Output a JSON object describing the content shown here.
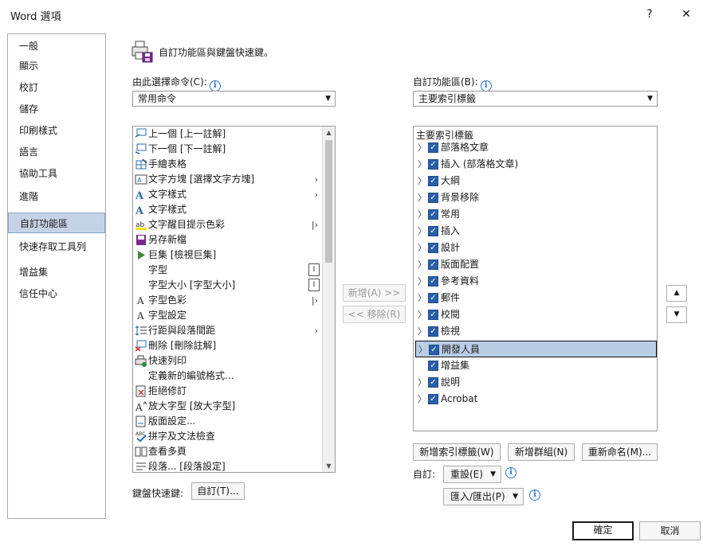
{
  "window": {
    "title": "Word 選項",
    "help_label": "?",
    "close_label": "✕"
  },
  "nav": {
    "items": [
      {
        "label": "一般"
      },
      {
        "label": "顯示"
      },
      {
        "label": "校訂"
      },
      {
        "label": "儲存"
      },
      {
        "label": "印刷樣式"
      },
      {
        "label": "語言"
      },
      {
        "label": "協助工具"
      },
      {
        "label": "進階"
      },
      {
        "label": "自訂功能區"
      },
      {
        "label": "快速存取工具列"
      },
      {
        "label": "增益集"
      },
      {
        "label": "信任中心"
      }
    ],
    "selected": "自訂功能區"
  },
  "header": {
    "title": "自訂功能區與鍵盤快速鍵。",
    "icon": "printer-disk-icon"
  },
  "left_panel": {
    "choose_label": "由此選擇命令(C):",
    "choose_value": "常用命令",
    "commands": [
      {
        "label": "上一個 [上一註解]",
        "icon": "prev-comment-icon",
        "suffix": ""
      },
      {
        "label": "下一個 [下一註解]",
        "icon": "next-comment-icon",
        "suffix": ""
      },
      {
        "label": "手繪表格",
        "icon": "draw-table-icon",
        "suffix": ""
      },
      {
        "label": "文字方塊 [選擇文字方塊]",
        "icon": "textbox-icon",
        "suffix": "›"
      },
      {
        "label": "文字樣式",
        "icon": "text-style-icon",
        "suffix": "›"
      },
      {
        "label": "文字樣式",
        "icon": "text-style-icon",
        "suffix": ""
      },
      {
        "label": "文字醒目提示色彩",
        "icon": "highlight-icon",
        "suffix": "|›"
      },
      {
        "label": "另存新檔",
        "icon": "save-as-icon",
        "suffix": ""
      },
      {
        "label": "巨集 [檢視巨集]",
        "icon": "macro-icon",
        "suffix": ""
      },
      {
        "label": "字型",
        "icon": "",
        "suffix": "I"
      },
      {
        "label": "字型大小 [字型大小]",
        "icon": "",
        "suffix": "I"
      },
      {
        "label": "字型色彩",
        "icon": "font-color-icon",
        "suffix": "|›"
      },
      {
        "label": "字型設定",
        "icon": "font-settings-icon",
        "suffix": ""
      },
      {
        "label": "行距與段落間距",
        "icon": "line-spacing-icon",
        "suffix": "›"
      },
      {
        "label": "刪除 [刪除註解]",
        "icon": "delete-comment-icon",
        "suffix": ""
      },
      {
        "label": "快速列印",
        "icon": "quick-print-icon",
        "suffix": ""
      },
      {
        "label": "定義新的編號格式...",
        "icon": "",
        "suffix": ""
      },
      {
        "label": "拒絕修訂",
        "icon": "reject-icon",
        "suffix": ""
      },
      {
        "label": "放大字型 [放大字型]",
        "icon": "grow-font-icon",
        "suffix": ""
      },
      {
        "label": "版面設定...",
        "icon": "page-setup-icon",
        "suffix": ""
      },
      {
        "label": "拼字及文法檢查",
        "icon": "spelling-icon",
        "suffix": ""
      },
      {
        "label": "查看多頁",
        "icon": "multi-page-icon",
        "suffix": ""
      },
      {
        "label": "段落... [段落設定]",
        "icon": "paragraph-icon",
        "suffix": ""
      }
    ],
    "shortcut_label": "鍵盤快速鍵:",
    "customize_button": "自訂(T)..."
  },
  "middle": {
    "add_button": "新增(A) >>",
    "remove_button": "<< 移除(R)"
  },
  "right_panel": {
    "ribbon_label": "自訂功能區(B):",
    "ribbon_value": "主要索引標籤",
    "tree_header": "主要索引標籤",
    "tabs": [
      {
        "label": "部落格文章",
        "expand": true,
        "selected": false
      },
      {
        "label": "插入 (部落格文章)",
        "expand": true,
        "selected": false
      },
      {
        "label": "大綱",
        "expand": true,
        "selected": false
      },
      {
        "label": "背景移除",
        "expand": true,
        "selected": false
      },
      {
        "label": "常用",
        "expand": true,
        "selected": false
      },
      {
        "label": "插入",
        "expand": true,
        "selected": false
      },
      {
        "label": "設計",
        "expand": true,
        "selected": false
      },
      {
        "label": "版面配置",
        "expand": true,
        "selected": false
      },
      {
        "label": "參考資料",
        "expand": true,
        "selected": false
      },
      {
        "label": "郵件",
        "expand": true,
        "selected": false
      },
      {
        "label": "校閱",
        "expand": true,
        "selected": false
      },
      {
        "label": "檢視",
        "expand": true,
        "selected": false
      },
      {
        "label": "開發人員",
        "expand": true,
        "selected": true
      },
      {
        "label": "增益集",
        "expand": false,
        "selected": false
      },
      {
        "label": "說明",
        "expand": true,
        "selected": false
      },
      {
        "label": "Acrobat",
        "expand": true,
        "selected": false
      }
    ],
    "new_tab_button": "新增索引標籤(W)",
    "new_group_button": "新增群組(N)",
    "rename_button": "重新命名(M)...",
    "customizations_label": "自訂:",
    "reset_button": "重設(E)",
    "import_export_button": "匯入/匯出(P)"
  },
  "footer": {
    "ok_button": "確定",
    "cancel_button": "取消"
  }
}
